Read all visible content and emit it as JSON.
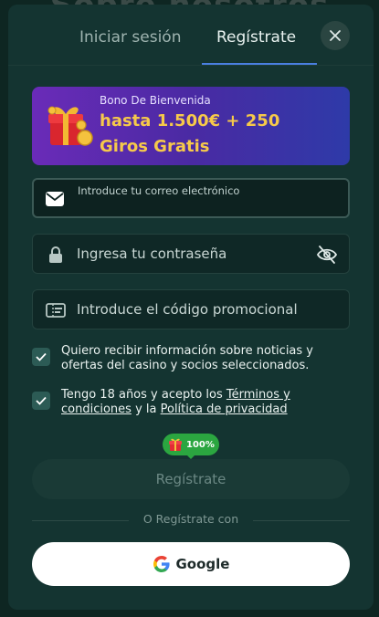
{
  "background": {
    "title": "Sobre nosotros"
  },
  "tabs": {
    "login": "Iniciar sesión",
    "register": "Regístrate"
  },
  "bonus": {
    "small": "Bono De Bienvenida",
    "line1": "hasta 1.500€ + 250",
    "line2": "Giros Gratis"
  },
  "form": {
    "email_label": "Introduce tu correo electrónico",
    "password_placeholder": "Ingresa tu contraseña",
    "promo_placeholder": "Introduce el código promocional"
  },
  "consents": {
    "newsletter": "Quiero recibir información sobre noticias y ofertas del casino y socios seleccionados.",
    "terms_prefix": "Tengo 18 años y acepto los ",
    "terms_link": "Términos y condiciones",
    "terms_middle": " y la ",
    "privacy_link": "Política de privacidad"
  },
  "badge": {
    "percent": "100%"
  },
  "submit_label": "Regístrate",
  "or_label": "O Regístrate con",
  "google_label": "Google",
  "colors": {
    "accent": "#4a7fe0",
    "bonus_text": "#f6c94a",
    "badge": "#2ba640"
  }
}
